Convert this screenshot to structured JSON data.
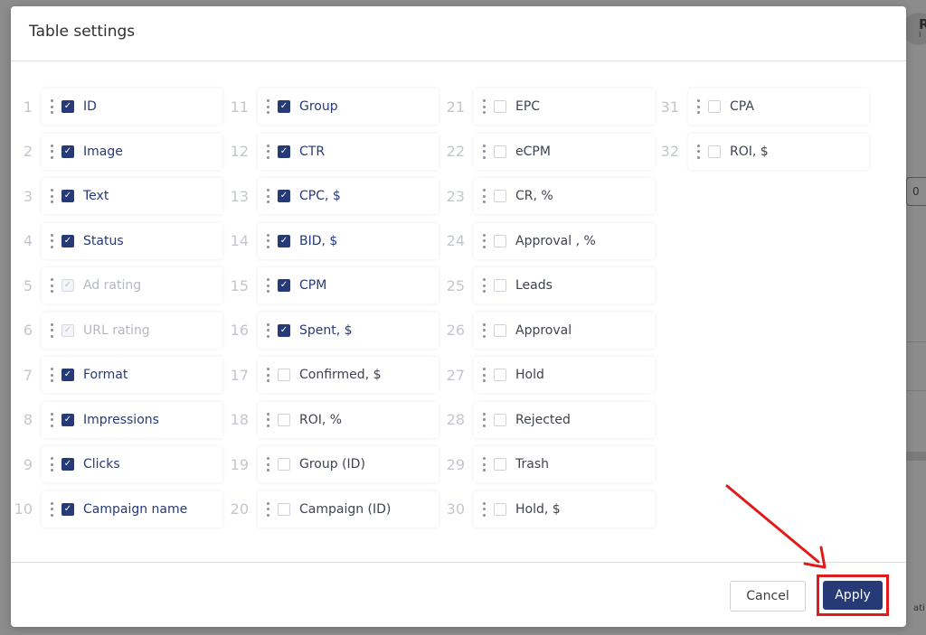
{
  "modal": {
    "title": "Table settings",
    "cancel_label": "Cancel",
    "apply_label": "Apply"
  },
  "columns": [
    [
      {
        "n": "1",
        "label": "ID",
        "state": "checked"
      },
      {
        "n": "2",
        "label": "Image",
        "state": "checked"
      },
      {
        "n": "3",
        "label": "Text",
        "state": "checked"
      },
      {
        "n": "4",
        "label": "Status",
        "state": "checked"
      },
      {
        "n": "5",
        "label": "Ad rating",
        "state": "disabled"
      },
      {
        "n": "6",
        "label": "URL rating",
        "state": "disabled"
      },
      {
        "n": "7",
        "label": "Format",
        "state": "checked"
      },
      {
        "n": "8",
        "label": "Impressions",
        "state": "checked"
      },
      {
        "n": "9",
        "label": "Clicks",
        "state": "checked"
      },
      {
        "n": "10",
        "label": "Campaign name",
        "state": "checked"
      }
    ],
    [
      {
        "n": "11",
        "label": "Group",
        "state": "checked"
      },
      {
        "n": "12",
        "label": "CTR",
        "state": "checked"
      },
      {
        "n": "13",
        "label": "CPC, $",
        "state": "checked"
      },
      {
        "n": "14",
        "label": "BID, $",
        "state": "checked"
      },
      {
        "n": "15",
        "label": "CPM",
        "state": "checked"
      },
      {
        "n": "16",
        "label": "Spent, $",
        "state": "checked"
      },
      {
        "n": "17",
        "label": "Confirmed, $",
        "state": "unchecked"
      },
      {
        "n": "18",
        "label": "ROI, %",
        "state": "unchecked"
      },
      {
        "n": "19",
        "label": "Group (ID)",
        "state": "unchecked"
      },
      {
        "n": "20",
        "label": "Campaign (ID)",
        "state": "unchecked"
      }
    ],
    [
      {
        "n": "21",
        "label": "EPC",
        "state": "unchecked"
      },
      {
        "n": "22",
        "label": "eCPM",
        "state": "unchecked"
      },
      {
        "n": "23",
        "label": "CR, %",
        "state": "unchecked"
      },
      {
        "n": "24",
        "label": "Approval , %",
        "state": "unchecked"
      },
      {
        "n": "25",
        "label": "Leads",
        "state": "unchecked"
      },
      {
        "n": "26",
        "label": "Approval",
        "state": "unchecked"
      },
      {
        "n": "27",
        "label": "Hold",
        "state": "unchecked"
      },
      {
        "n": "28",
        "label": "Rejected",
        "state": "unchecked"
      },
      {
        "n": "29",
        "label": "Trash",
        "state": "unchecked"
      },
      {
        "n": "30",
        "label": "Hold, $",
        "state": "unchecked"
      }
    ],
    [
      {
        "n": "31",
        "label": "CPA",
        "state": "unchecked"
      },
      {
        "n": "32",
        "label": "ROI, $",
        "state": "unchecked"
      }
    ]
  ],
  "colors": {
    "accent": "#263a78",
    "highlight": "#e01b1b"
  },
  "icons": {
    "checked": "check-icon",
    "drag": "drag-handle-icon",
    "annotation": "red-arrow-icon"
  },
  "background": {
    "field_value": "0",
    "partial_name": "R",
    "partial_sub": "I",
    "partial_text": "ati"
  }
}
